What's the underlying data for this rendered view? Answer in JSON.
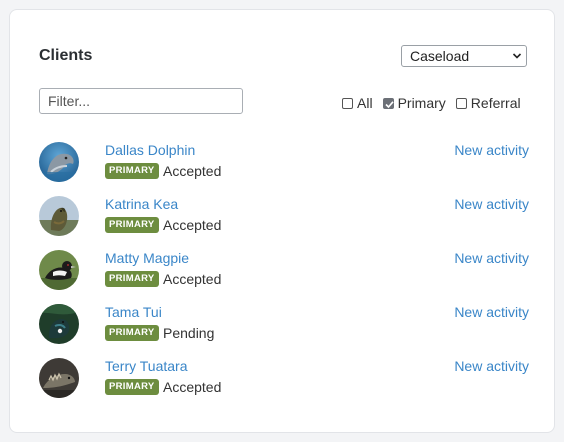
{
  "header": {
    "title": "Clients",
    "view_select": {
      "selected": "Caseload"
    }
  },
  "filter": {
    "placeholder": "Filter..."
  },
  "checkboxes": [
    {
      "label": "All",
      "checked": false
    },
    {
      "label": "Primary",
      "checked": true
    },
    {
      "label": "Referral",
      "checked": false
    }
  ],
  "clients": [
    {
      "name": "Dallas Dolphin",
      "badge": "PRIMARY",
      "status": "Accepted",
      "action": "New activity"
    },
    {
      "name": "Katrina Kea",
      "badge": "PRIMARY",
      "status": "Accepted",
      "action": "New activity"
    },
    {
      "name": "Matty Magpie",
      "badge": "PRIMARY",
      "status": "Accepted",
      "action": "New activity"
    },
    {
      "name": "Tama Tui",
      "badge": "PRIMARY",
      "status": "Pending",
      "action": "New activity"
    },
    {
      "name": "Terry Tuatara",
      "badge": "PRIMARY",
      "status": "Accepted",
      "action": "New activity"
    }
  ],
  "colors": {
    "link": "#3a86c8",
    "badge": "#6d8d3f"
  }
}
